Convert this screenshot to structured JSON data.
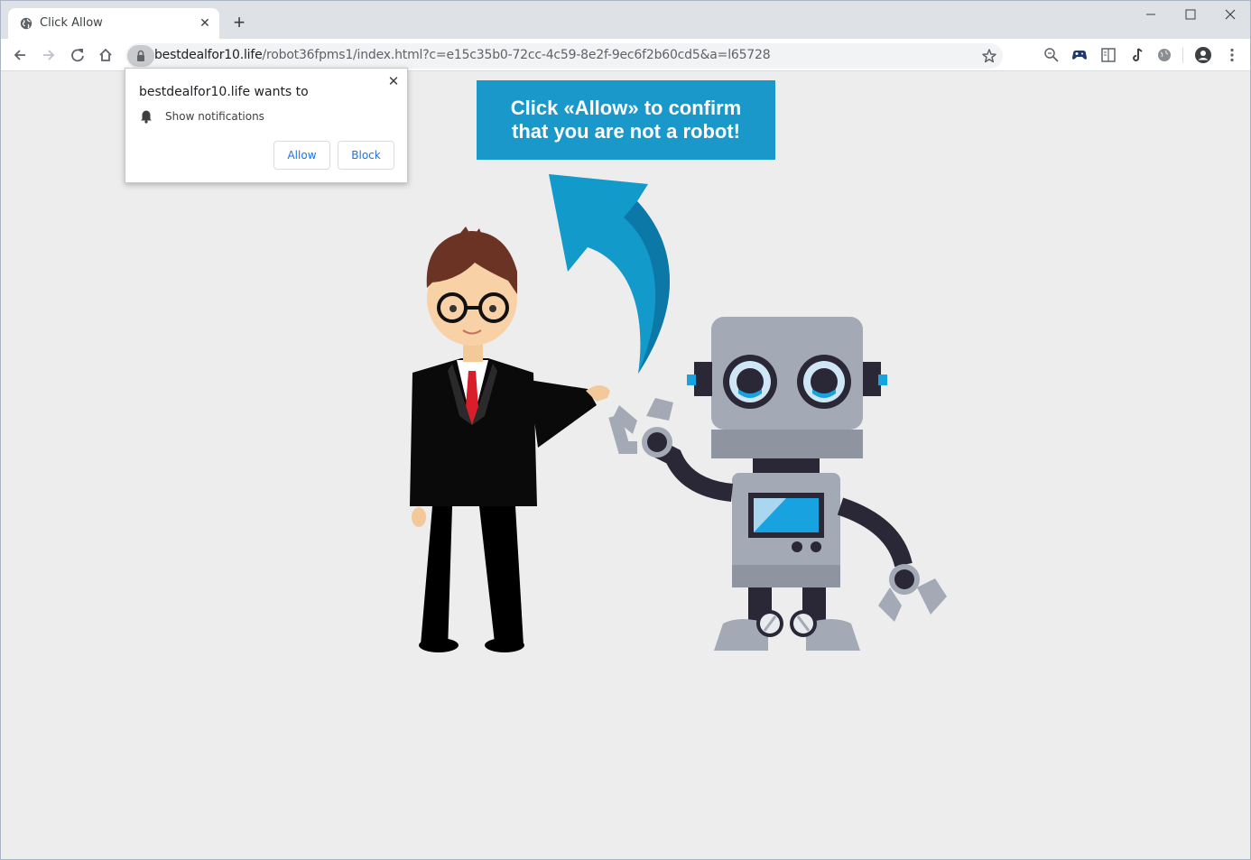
{
  "tab": {
    "title": "Click Allow",
    "icon": "globe-icon"
  },
  "address_bar": {
    "domain": "bestdealfor10.life",
    "path": "/robot36fpms1/index.html?c=e15c35b0-72cc-4c59-8e2f-9ec6f2b60cd5&a=l65728"
  },
  "permission_popup": {
    "heading": "bestdealfor10.life wants to",
    "permission": "Show notifications",
    "allow_label": "Allow",
    "block_label": "Block"
  },
  "banner": {
    "line1": "Click «Allow» to confirm",
    "line2": "that you are not a robot!",
    "color": "#1a98c9"
  }
}
